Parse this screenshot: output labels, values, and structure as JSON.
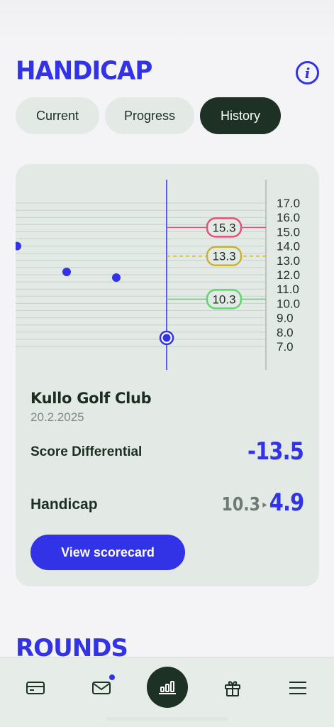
{
  "header": {
    "title": "HANDICAP",
    "info_icon": "info-icon",
    "info_glyph": "i"
  },
  "tabs": [
    {
      "label": "Current",
      "active": false
    },
    {
      "label": "Progress",
      "active": false
    },
    {
      "label": "History",
      "active": true
    }
  ],
  "chart_data": {
    "type": "scatter",
    "y_ticks": [
      "17.0",
      "16.0",
      "15.0",
      "14.0",
      "13.0",
      "12.0",
      "11.0",
      "10.0",
      "9.0",
      "8.0",
      "7.0"
    ],
    "ylim": [
      7.0,
      17.0
    ],
    "points": [
      {
        "x": 0,
        "y": 14.0
      },
      {
        "x": 1,
        "y": 12.2
      },
      {
        "x": 2,
        "y": 11.8
      },
      {
        "x": 3,
        "y": 7.6,
        "selected": true
      }
    ],
    "reference_lines": [
      {
        "value": 15.3,
        "label": "15.3",
        "color": "#e2527a",
        "style": "solid"
      },
      {
        "value": 13.3,
        "label": "13.3",
        "color": "#c9b336",
        "style": "dashed"
      },
      {
        "value": 10.3,
        "label": "10.3",
        "color": "#5fd66c",
        "style": "solid"
      }
    ],
    "colors": {
      "point": "#3232e6",
      "grid": "#c6d2cb",
      "axis": "#b8c6bd"
    }
  },
  "round": {
    "club": "Kullo Golf Club",
    "date": "20.2.2025",
    "score_differential_label": "Score Differential",
    "score_differential_value": "-13.5",
    "handicap_label": "Handicap",
    "handicap_from": "10.3",
    "handicap_arrow": "▸",
    "handicap_to": "4.9",
    "cta_label": "View scorecard"
  },
  "rounds_section": {
    "title": "ROUNDS"
  },
  "nav": [
    {
      "name": "card-icon",
      "active": false
    },
    {
      "name": "mail-icon",
      "active": false,
      "badge": true
    },
    {
      "name": "stats-icon",
      "active": true
    },
    {
      "name": "gift-icon",
      "active": false
    },
    {
      "name": "menu-icon",
      "active": false
    }
  ],
  "colors": {
    "accent": "#3232e6",
    "dark": "#1d3125",
    "card": "#e3eae6"
  }
}
